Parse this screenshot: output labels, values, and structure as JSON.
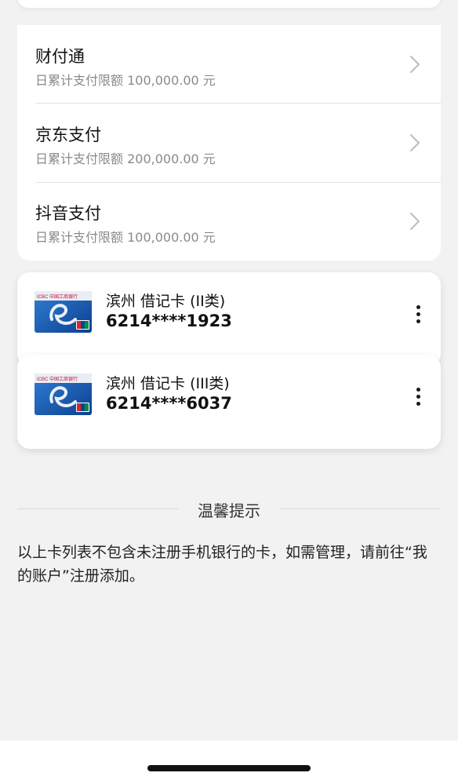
{
  "payment_methods": [
    {
      "name": "财付通",
      "limit": "日累计支付限额 100,000.00 元"
    },
    {
      "name": "京东支付",
      "limit": "日累计支付限额 200,000.00 元"
    },
    {
      "name": "抖音支付",
      "limit": "日累计支付限额 100,000.00 元"
    }
  ],
  "cards": [
    {
      "bank": "滨州 借记卡 (II类)",
      "number": "6214****1923"
    },
    {
      "bank": "滨州 借记卡 (III类)",
      "number": "6214****6037"
    }
  ],
  "card_logo_text": "ICBC 中国工商银行",
  "notice": {
    "title": "温馨提示",
    "body": "以上卡列表不包含未注册手机银行的卡，如需管理，请前往“我的账户”注册添加。"
  },
  "colors": {
    "background": "#f2f2f2",
    "card": "#ffffff",
    "secondary_text": "#8a8a8a",
    "card_blue": "#1b5fb8"
  }
}
